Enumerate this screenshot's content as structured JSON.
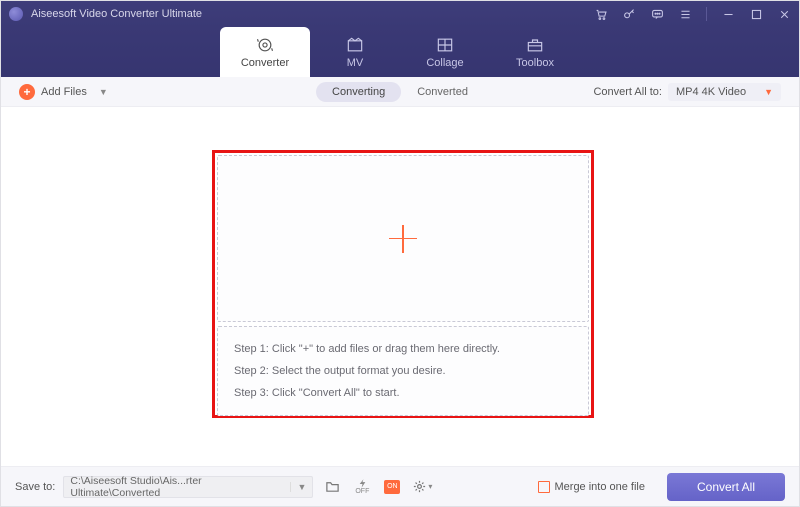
{
  "app": {
    "title": "Aiseesoft Video Converter Ultimate"
  },
  "tabs": [
    {
      "label": "Converter"
    },
    {
      "label": "MV"
    },
    {
      "label": "Collage"
    },
    {
      "label": "Toolbox"
    }
  ],
  "toolbar": {
    "add_files": "Add Files",
    "sub_converting": "Converting",
    "sub_converted": "Converted",
    "convert_all_to": "Convert All to:",
    "format": "MP4 4K Video"
  },
  "steps": {
    "s1": "Step 1: Click \"+\" to add files or drag them here directly.",
    "s2": "Step 2: Select the output format you desire.",
    "s3": "Step 3: Click \"Convert All\" to start."
  },
  "footer": {
    "save_to": "Save to:",
    "path": "C:\\Aiseesoft Studio\\Ais...rter Ultimate\\Converted",
    "merge": "Merge into one file",
    "convert_all": "Convert All"
  }
}
